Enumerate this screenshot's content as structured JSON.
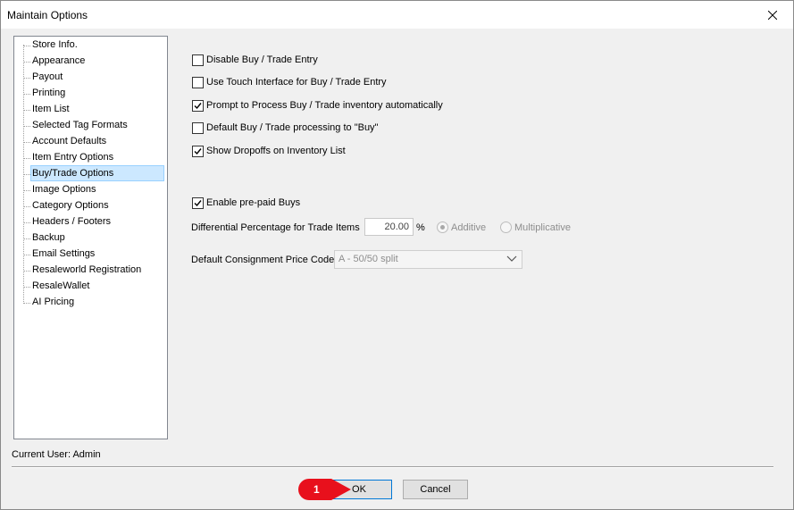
{
  "window": {
    "title": "Maintain Options"
  },
  "sidebar": {
    "items": [
      {
        "label": "Store Info."
      },
      {
        "label": "Appearance"
      },
      {
        "label": "Payout"
      },
      {
        "label": "Printing"
      },
      {
        "label": "Item List"
      },
      {
        "label": "Selected Tag Formats"
      },
      {
        "label": "Account Defaults"
      },
      {
        "label": "Item Entry Options"
      },
      {
        "label": "Buy/Trade Options",
        "selected": true
      },
      {
        "label": "Image Options"
      },
      {
        "label": "Category Options"
      },
      {
        "label": "Headers / Footers"
      },
      {
        "label": "Backup"
      },
      {
        "label": "Email Settings"
      },
      {
        "label": "Resaleworld Registration"
      },
      {
        "label": "ResaleWallet"
      },
      {
        "label": "AI Pricing"
      }
    ]
  },
  "options": {
    "disable_buy_trade": {
      "label": "Disable Buy / Trade Entry",
      "checked": false
    },
    "touch_interface": {
      "label": "Use Touch Interface for Buy / Trade Entry",
      "checked": false
    },
    "prompt_process": {
      "label": "Prompt to Process Buy / Trade inventory automatically",
      "checked": true
    },
    "default_buy": {
      "label": "Default Buy / Trade processing to \"Buy\"",
      "checked": false
    },
    "show_dropoffs": {
      "label": "Show Dropoffs on Inventory List",
      "checked": true
    },
    "enable_prepaid": {
      "label": "Enable pre-paid Buys",
      "checked": true
    }
  },
  "differential": {
    "label": "Differential Percentage for Trade Items",
    "value": "20.00",
    "unit": "%",
    "additive_label": "Additive",
    "additive_selected": true,
    "multiplicative_label": "Multiplicative",
    "multiplicative_selected": false
  },
  "consignment": {
    "label": "Default Consignment Price Code",
    "value": "A - 50/50 split"
  },
  "status": {
    "current_user": "Current User: Admin"
  },
  "buttons": {
    "ok": "OK",
    "cancel": "Cancel"
  },
  "annotation": {
    "number": "1",
    "color": "#e8101c"
  },
  "colors": {
    "selection": "#cce8ff",
    "accent": "#0078d7"
  }
}
